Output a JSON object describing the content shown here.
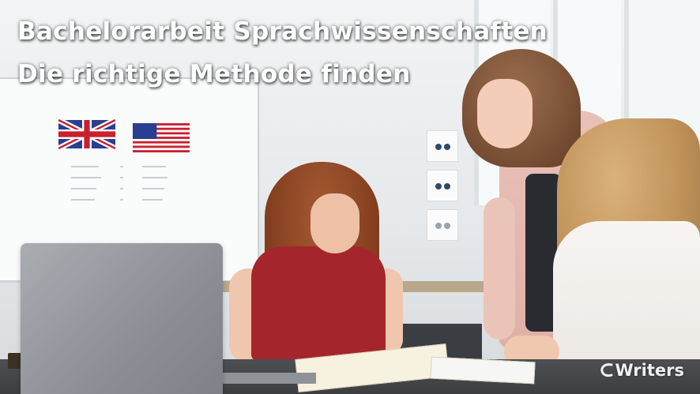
{
  "headline": {
    "line1": "Bachelorarbeit Sprachwissenschaften",
    "line2": "Die richtige Methode finden"
  },
  "watermark": {
    "text": "Writers",
    "icon": "writers-logo-icon"
  },
  "photo": {
    "subject_icon": "classroom-photo"
  },
  "colors": {
    "headline_text": "#ffffff",
    "red_shirt": "#a4262c",
    "blazer_pink": "#e9c1b8"
  }
}
